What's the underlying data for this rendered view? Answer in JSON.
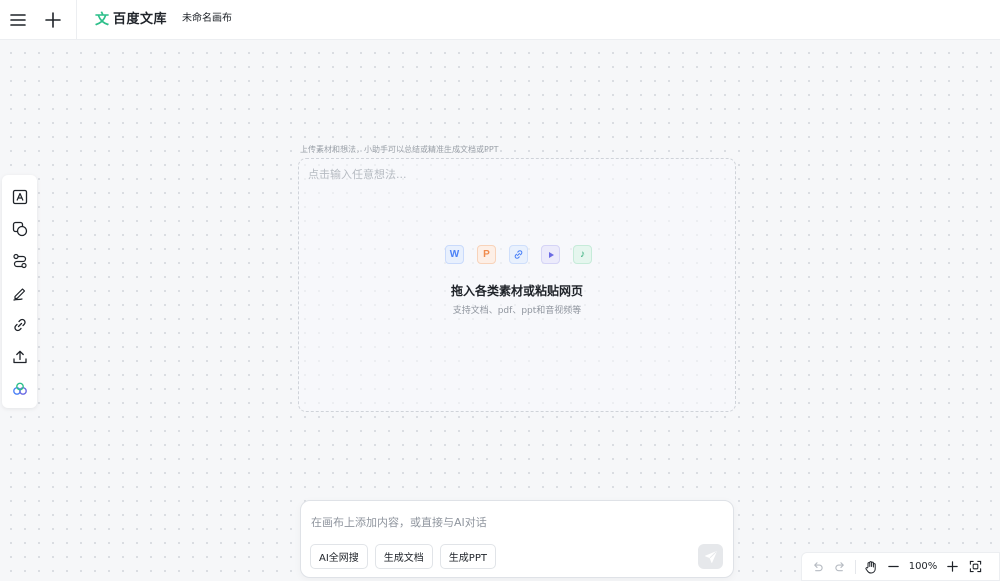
{
  "topbar": {
    "logo_mark": "文",
    "logo_text": "百度文库",
    "doc_title": "未命名画布"
  },
  "left_toolbar": {
    "items": [
      {
        "icon": "text-box-icon"
      },
      {
        "icon": "shapes-icon"
      },
      {
        "icon": "connector-icon"
      },
      {
        "icon": "pen-icon"
      },
      {
        "icon": "link-icon"
      },
      {
        "icon": "upload-icon"
      },
      {
        "icon": "ai-assistant-icon"
      }
    ]
  },
  "upload": {
    "hint": "上传素材和想法，小助手可以总结或精准生成文档或PPT",
    "placeholder": "点击输入任意想法...",
    "file_types": [
      {
        "icon": "word-file-icon",
        "glyph": "W"
      },
      {
        "icon": "ppt-file-icon",
        "glyph": "P"
      },
      {
        "icon": "link-file-icon",
        "glyph": "⊘"
      },
      {
        "icon": "video-file-icon",
        "glyph": "▶"
      },
      {
        "icon": "audio-file-icon",
        "glyph": "♪"
      }
    ],
    "drop_title": "拖入各类素材或粘贴网页",
    "drop_subtitle": "支持文档、pdf、ppt和音视频等"
  },
  "chat": {
    "placeholder": "在画布上添加内容，或直接与AI对话",
    "chips": [
      "AI全网搜",
      "生成文档",
      "生成PPT"
    ]
  },
  "zoom": {
    "level": "100%"
  },
  "colors": {
    "brand_green": "#2dbf8a",
    "canvas_bg": "#f6f7f9"
  }
}
